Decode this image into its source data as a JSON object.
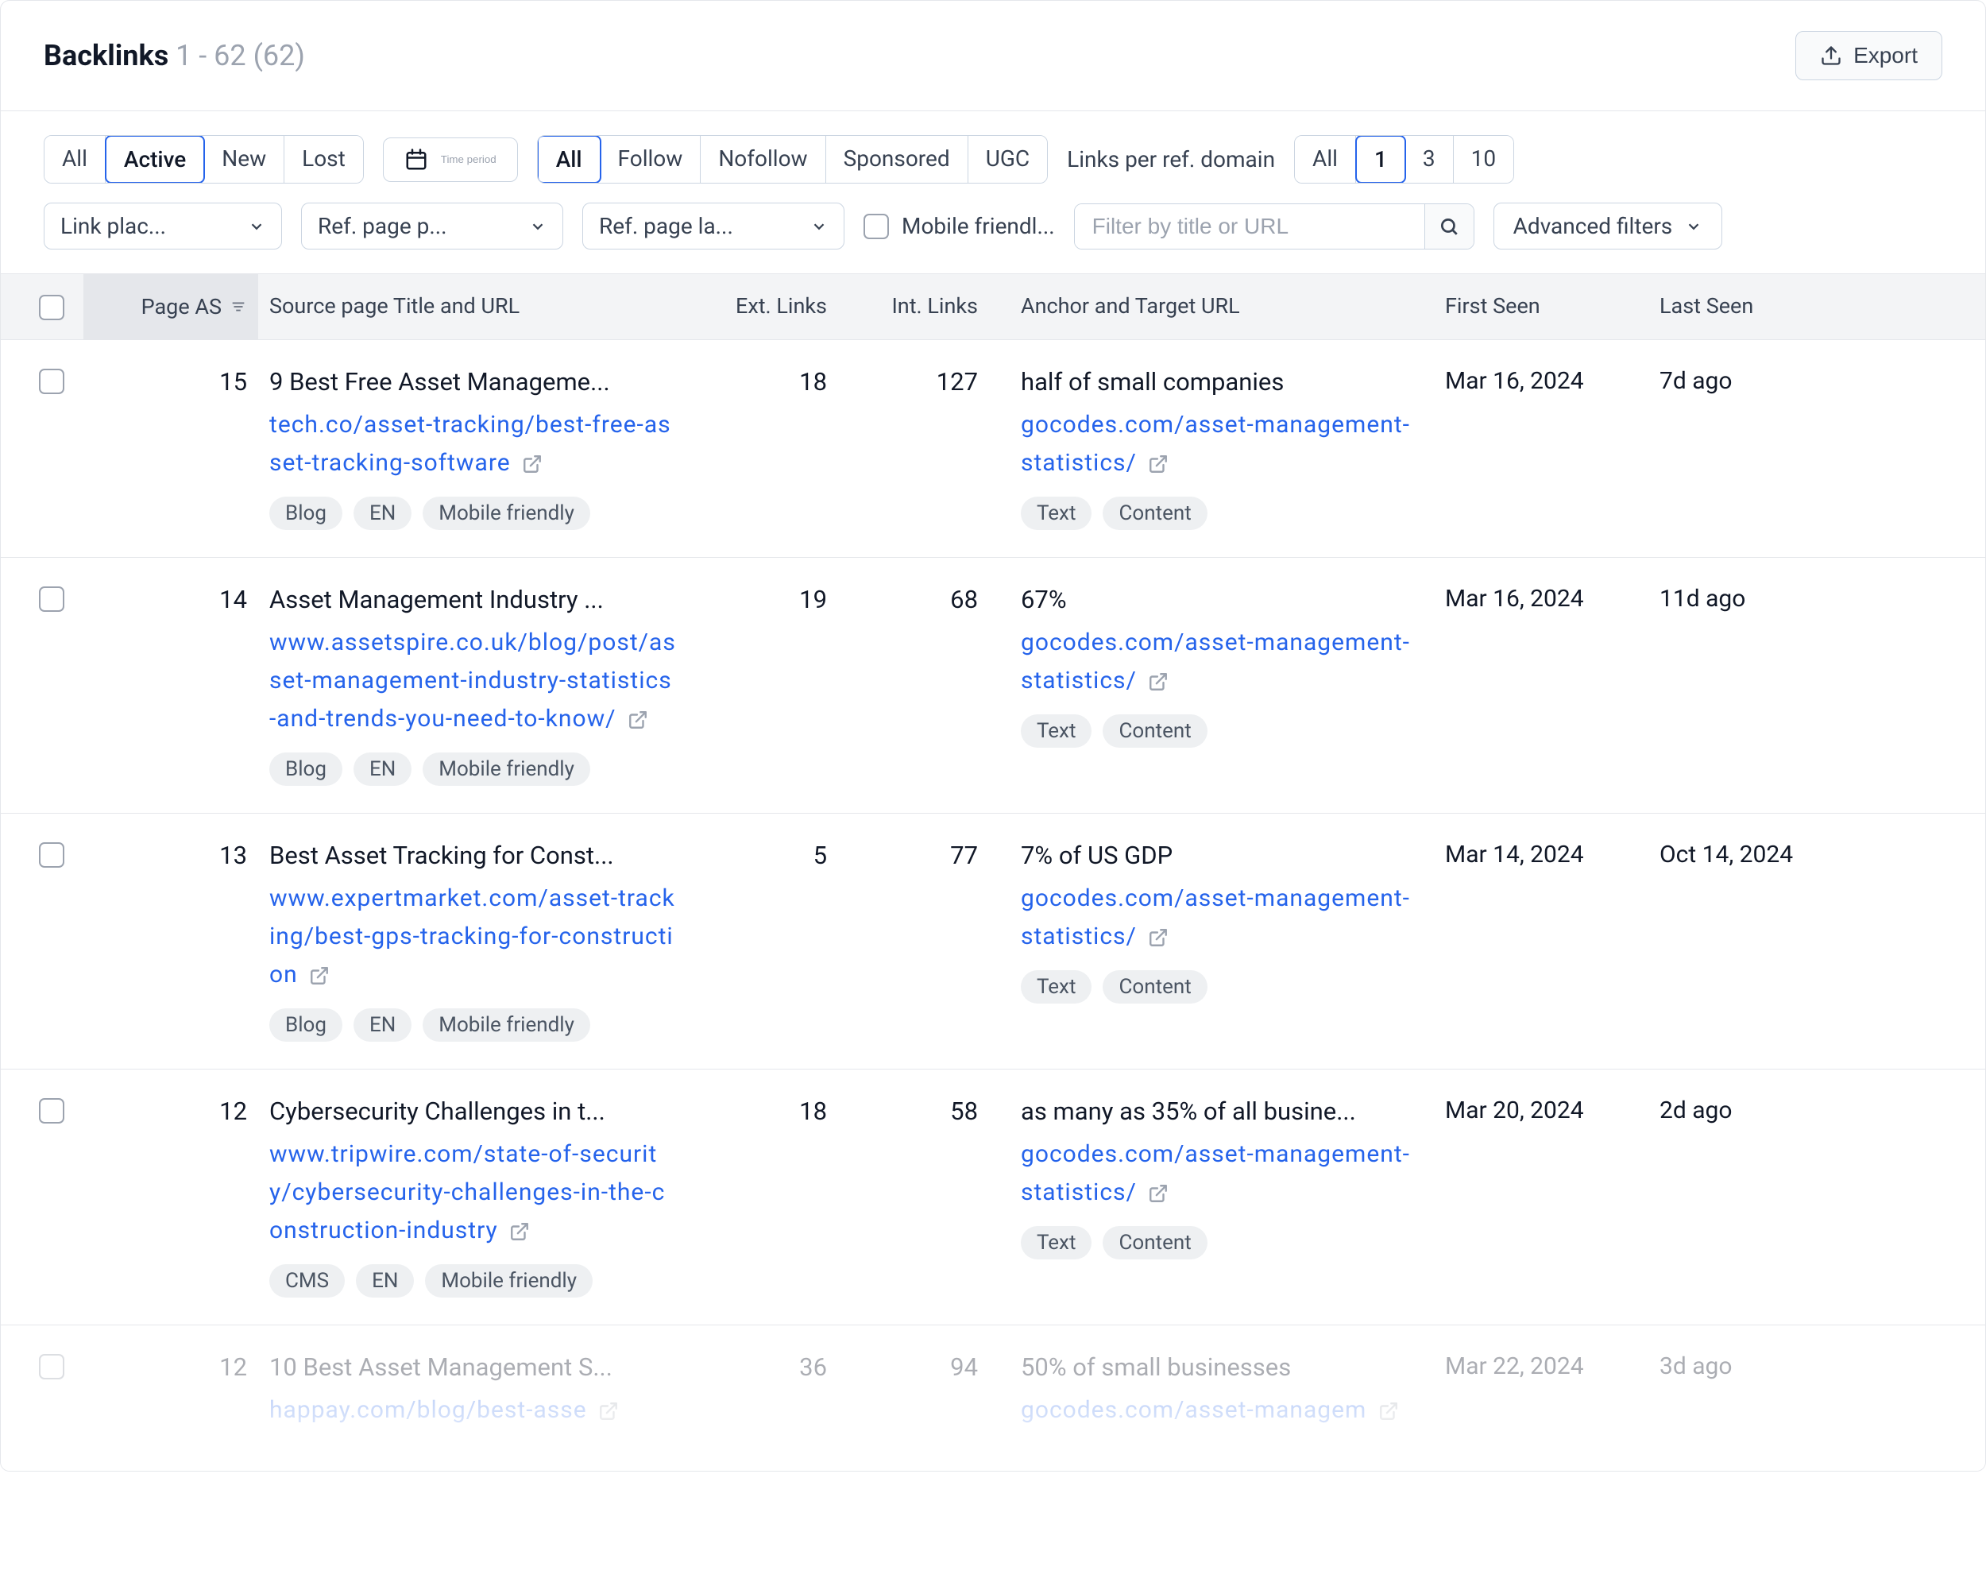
{
  "header": {
    "title": "Backlinks",
    "range": "1 - 62 (62)",
    "export": "Export"
  },
  "filters": {
    "status": {
      "items": [
        "All",
        "Active",
        "New",
        "Lost"
      ],
      "active_index": 1
    },
    "time_period": "Time period",
    "follow": {
      "items": [
        "All",
        "Follow",
        "Nofollow",
        "Sponsored",
        "UGC"
      ],
      "active_index": 0
    },
    "links_per_domain_label": "Links per ref. domain",
    "links_per_domain": {
      "items": [
        "All",
        "1",
        "3",
        "10"
      ],
      "active_index": 1
    },
    "link_placement": "Link plac...",
    "ref_page_p": "Ref. page p...",
    "ref_page_la": "Ref. page la...",
    "mobile_friendly": "Mobile friendl...",
    "search_placeholder": "Filter by title or URL",
    "advanced_filters": "Advanced filters"
  },
  "columns": {
    "page_as": "Page AS",
    "source": "Source page Title and URL",
    "ext": "Ext. Links",
    "int": "Int. Links",
    "anchor": "Anchor and Target URL",
    "first_seen": "First Seen",
    "last_seen": "Last Seen"
  },
  "rows": [
    {
      "page_as": "15",
      "title": "9 Best Free Asset Manageme...",
      "url": "tech.co/asset-tracking/best-free-asset-tracking-software",
      "source_pills": [
        "Blog",
        "EN",
        "Mobile friendly"
      ],
      "ext": "18",
      "int": "127",
      "anchor_text": "half of small companies",
      "target_url": "gocodes.com/asset-management-statistics/",
      "anchor_pills": [
        "Text",
        "Content"
      ],
      "first_seen": "Mar 16, 2024",
      "last_seen": "7d ago"
    },
    {
      "page_as": "14",
      "title": "Asset Management Industry ...",
      "url": "www.assetspire.co.uk/blog/post/asset-management-industry-statistics-and-trends-you-need-to-know/",
      "source_pills": [
        "Blog",
        "EN",
        "Mobile friendly"
      ],
      "ext": "19",
      "int": "68",
      "anchor_text": "67%",
      "target_url": "gocodes.com/asset-management-statistics/",
      "anchor_pills": [
        "Text",
        "Content"
      ],
      "first_seen": "Mar 16, 2024",
      "last_seen": "11d ago"
    },
    {
      "page_as": "13",
      "title": "Best Asset Tracking for Const...",
      "url": "www.expertmarket.com/asset-tracking/best-gps-tracking-for-construction",
      "source_pills": [
        "Blog",
        "EN",
        "Mobile friendly"
      ],
      "ext": "5",
      "int": "77",
      "anchor_text": "7% of US GDP",
      "target_url": "gocodes.com/asset-management-statistics/",
      "anchor_pills": [
        "Text",
        "Content"
      ],
      "first_seen": "Mar 14, 2024",
      "last_seen": "Oct 14, 2024"
    },
    {
      "page_as": "12",
      "title": "Cybersecurity Challenges in t...",
      "url": "www.tripwire.com/state-of-security/cybersecurity-challenges-in-the-construction-industry",
      "source_pills": [
        "CMS",
        "EN",
        "Mobile friendly"
      ],
      "ext": "18",
      "int": "58",
      "anchor_text": "as many as 35% of all busine...",
      "target_url": "gocodes.com/asset-management-statistics/",
      "anchor_pills": [
        "Text",
        "Content"
      ],
      "first_seen": "Mar 20, 2024",
      "last_seen": "2d ago"
    },
    {
      "page_as": "12",
      "title": "10 Best Asset Management S...",
      "url": "happay.com/blog/best-asse",
      "source_pills": [],
      "ext": "36",
      "int": "94",
      "anchor_text": "50% of small businesses",
      "target_url": "gocodes.com/asset-managem",
      "anchor_pills": [],
      "first_seen": "Mar 22, 2024",
      "last_seen": "3d ago"
    }
  ]
}
